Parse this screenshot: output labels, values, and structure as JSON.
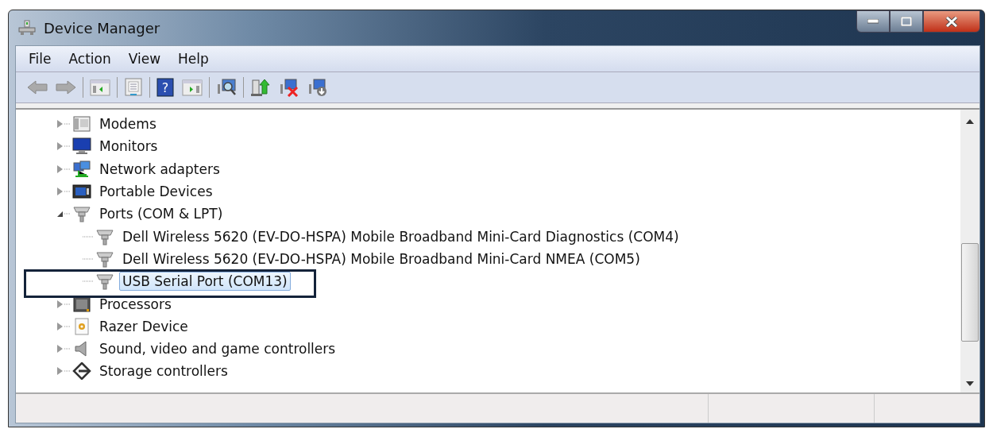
{
  "window": {
    "title": "Device Manager"
  },
  "menu": [
    "File",
    "Action",
    "View",
    "Help"
  ],
  "toolbar": {
    "help_glyph": "?"
  },
  "tree": [
    {
      "label": "Modems",
      "kind": "modem",
      "expanded": false,
      "selected": false
    },
    {
      "label": "Monitors",
      "kind": "monitor",
      "expanded": false,
      "selected": false
    },
    {
      "label": "Network adapters",
      "kind": "network",
      "expanded": false,
      "selected": false
    },
    {
      "label": "Portable Devices",
      "kind": "portable",
      "expanded": false,
      "selected": false
    },
    {
      "label": "Ports (COM & LPT)",
      "kind": "port",
      "expanded": true,
      "selected": false,
      "children": [
        {
          "label": "Dell Wireless 5620 (EV-DO-HSPA) Mobile Broadband Mini-Card Diagnostics (COM4)",
          "kind": "port",
          "selected": false
        },
        {
          "label": "Dell Wireless 5620 (EV-DO-HSPA) Mobile Broadband Mini-Card NMEA (COM5)",
          "kind": "port",
          "selected": false
        },
        {
          "label": "USB Serial Port (COM13)",
          "kind": "port",
          "selected": true
        }
      ]
    },
    {
      "label": "Processors",
      "kind": "processor",
      "expanded": false,
      "selected": false
    },
    {
      "label": "Razer Device",
      "kind": "razer",
      "expanded": false,
      "selected": false
    },
    {
      "label": "Sound, video and game controllers",
      "kind": "sound",
      "expanded": false,
      "selected": false
    },
    {
      "label": "Storage controllers",
      "kind": "storage",
      "expanded": false,
      "selected": false
    }
  ]
}
